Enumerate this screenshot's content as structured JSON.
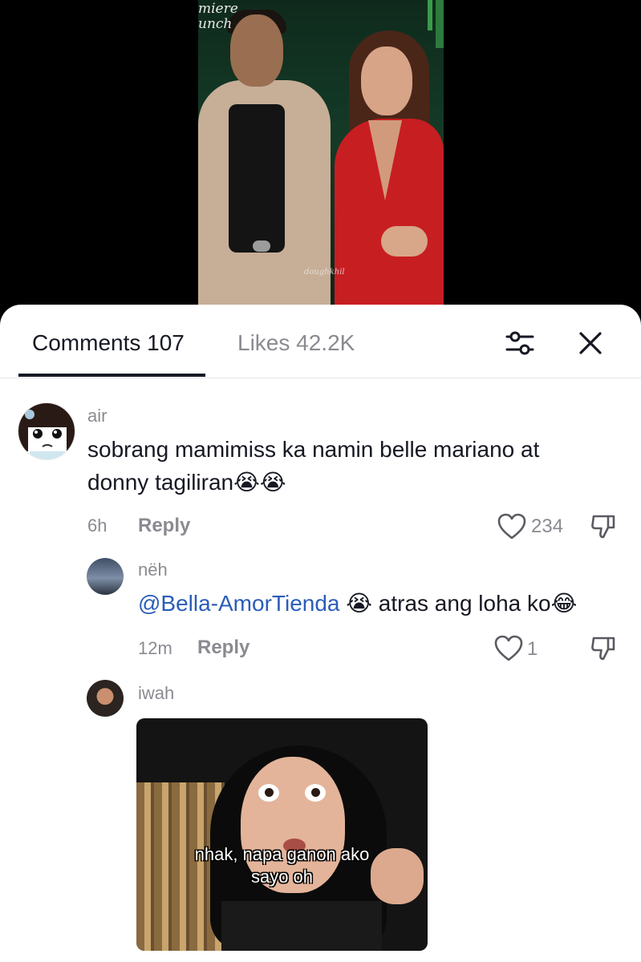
{
  "video": {
    "watermark_line1": "miere",
    "watermark_line2": "unch",
    "signature": "doughkhil"
  },
  "tabs": {
    "comments_label": "Comments 107",
    "likes_label": "Likes 42.2K"
  },
  "icons": {
    "filter": "sliders-filter-icon",
    "close": "close-x-icon",
    "like": "heart-outline-icon",
    "dislike": "thumbs-down-outline-icon"
  },
  "comments": [
    {
      "username": "air",
      "text": "sobrang mamimiss ka namin belle mariano at donny tagiliran",
      "emojis": "😭😭",
      "time": "6h",
      "reply_label": "Reply",
      "likes": "234"
    },
    {
      "username": "nëh",
      "mention": "@Bella-AmorTienda",
      "emoji_after_mention": "😭",
      "text": "atras ang loha ko",
      "emoji_end": "😂",
      "time": "12m",
      "reply_label": "Reply",
      "likes": "1"
    },
    {
      "username": "iwah",
      "gif_caption_line1": "nhak, napa ganon ako",
      "gif_caption_line2": "sayo oh"
    }
  ],
  "colors": {
    "text_primary": "#161823",
    "text_secondary": "#8a8b91",
    "mention": "#2b5db9",
    "divider": "#e3e3e4"
  }
}
